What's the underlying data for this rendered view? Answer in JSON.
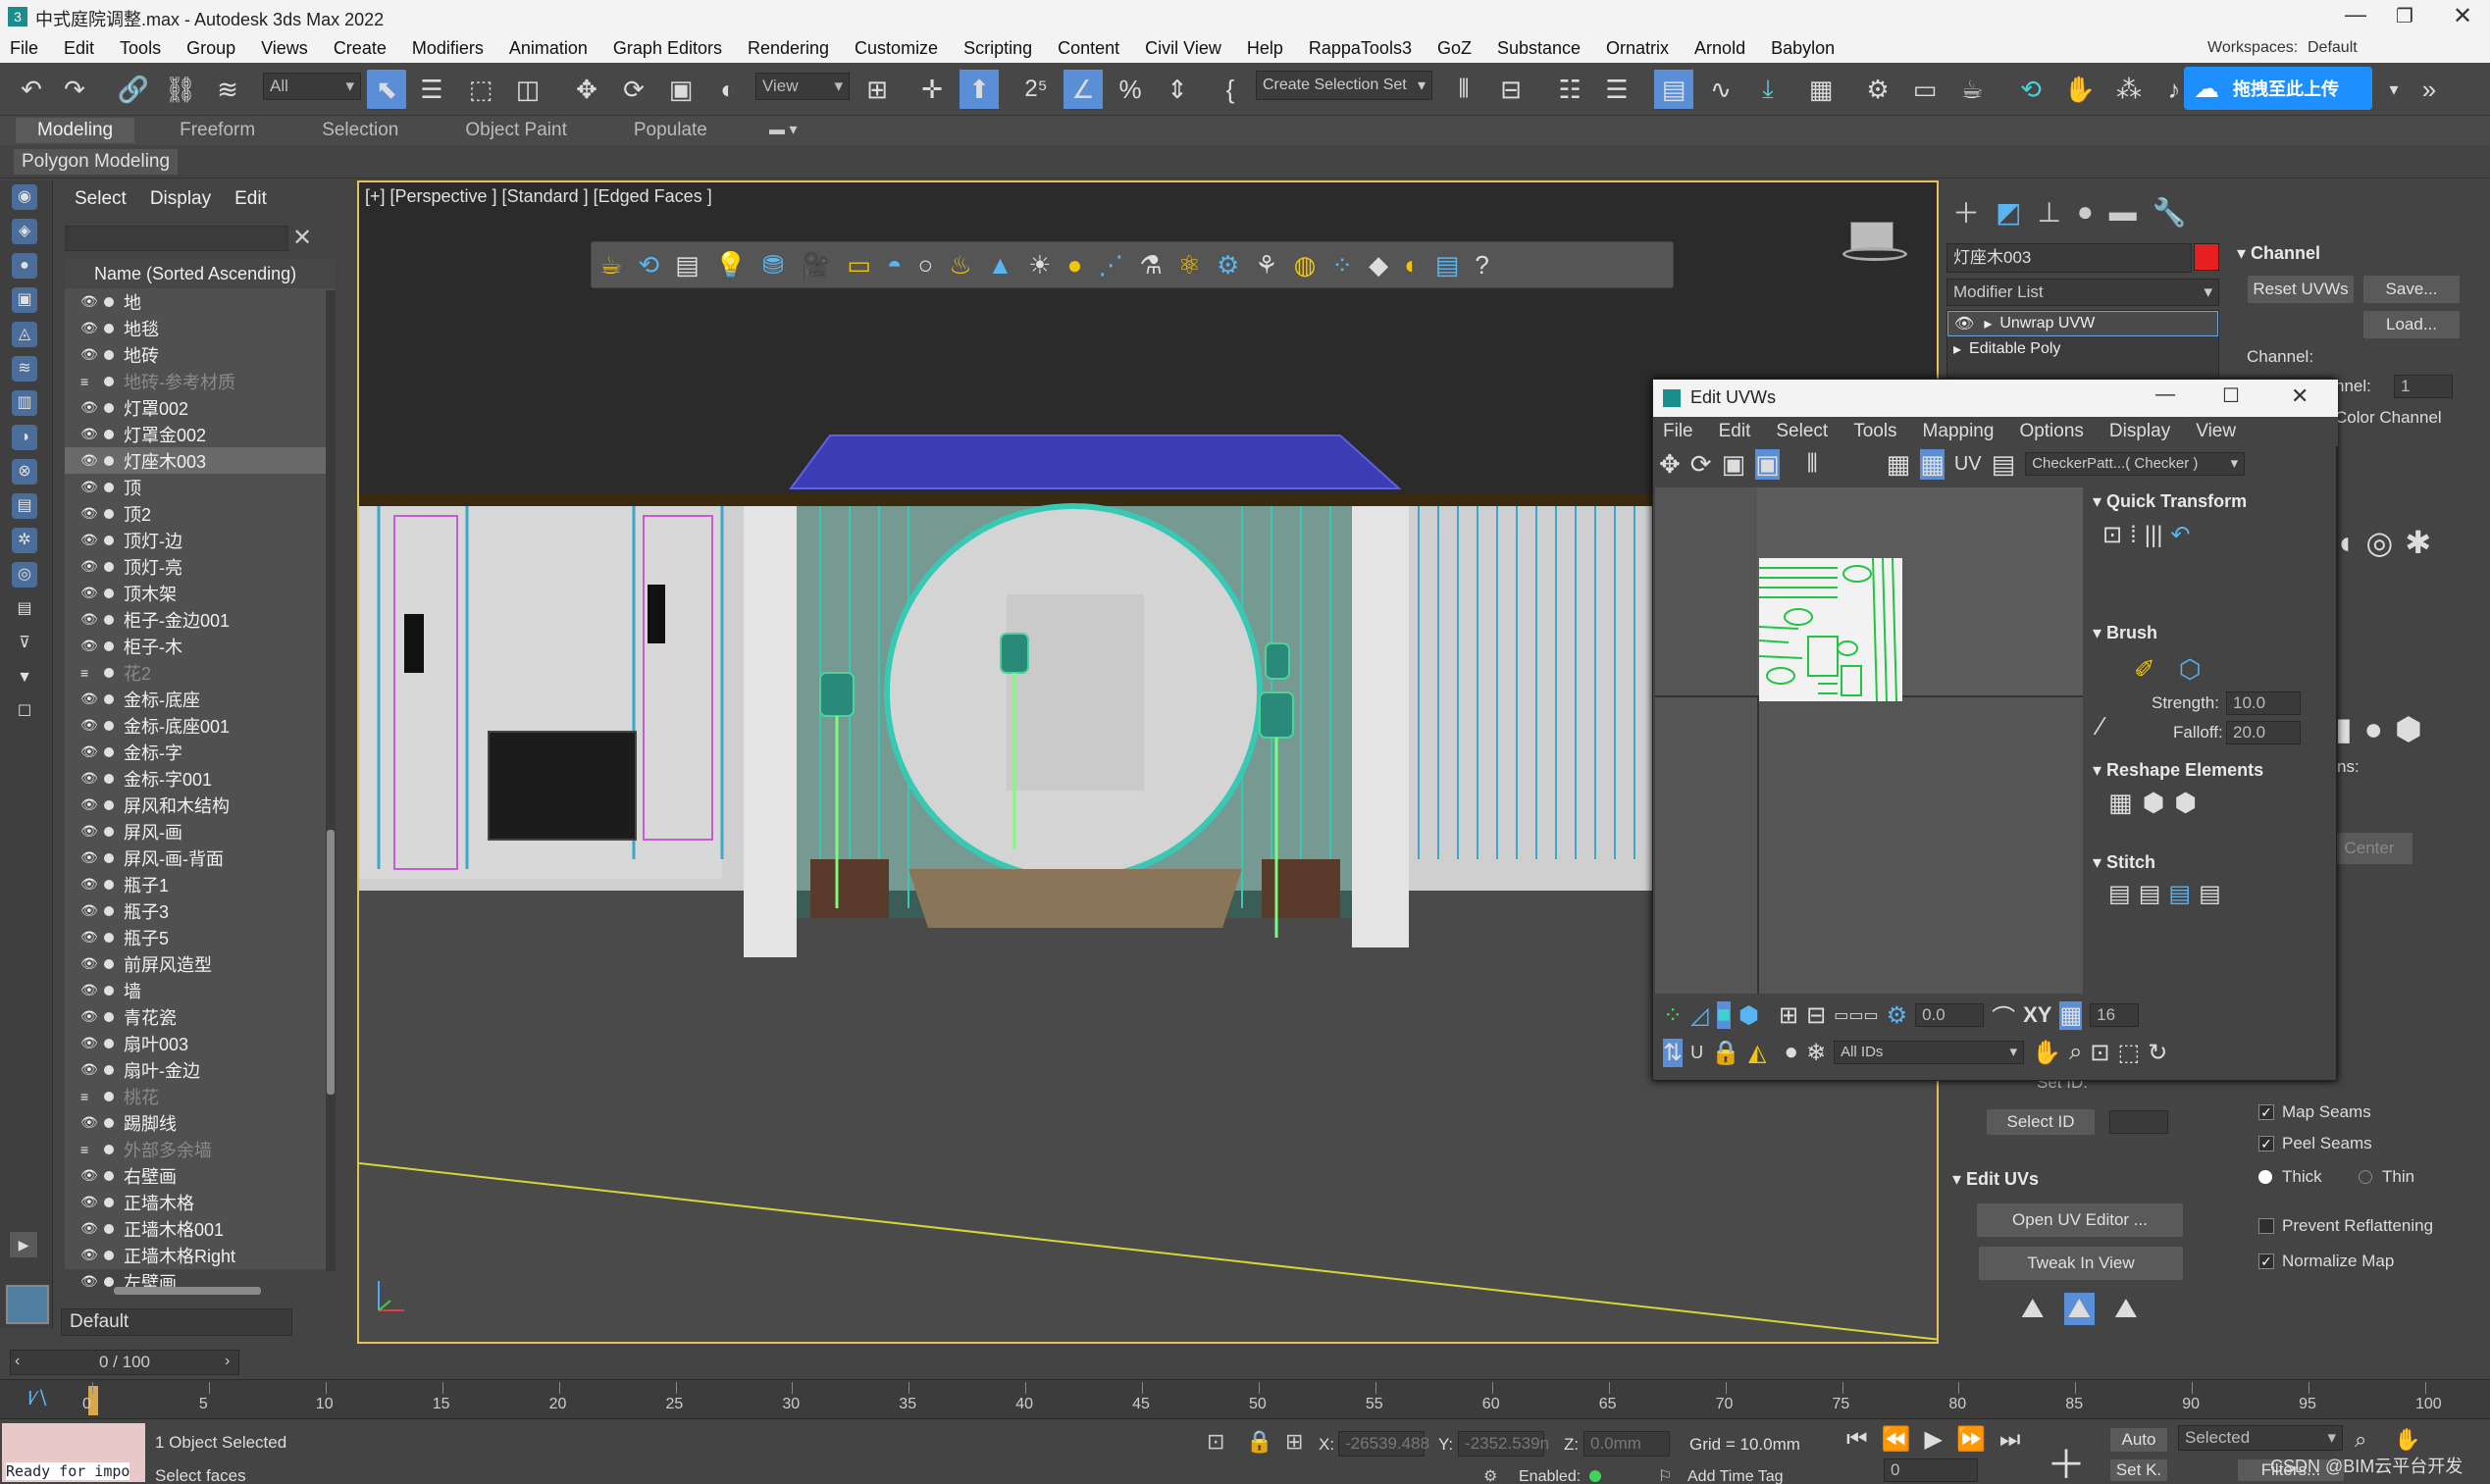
{
  "window": {
    "title": "中式庭院调整.max - Autodesk 3ds Max 2022",
    "workspaces_label": "Workspaces:",
    "workspace_value": "Default"
  },
  "menu": [
    "File",
    "Edit",
    "Tools",
    "Group",
    "Views",
    "Create",
    "Modifiers",
    "Animation",
    "Graph Editors",
    "Rendering",
    "Customize",
    "Scripting",
    "Content",
    "Civil View",
    "Help",
    "RappaTools3",
    "GoZ",
    "Substance",
    "Ornatrix",
    "Arnold",
    "Babylon"
  ],
  "toolbar": {
    "filter_value": "All",
    "refcoord_value": "View",
    "selection_set": "Create Selection Set",
    "upload_label": "拖拽至此上传"
  },
  "ribbon": {
    "tabs": [
      "Modeling",
      "Freeform",
      "Selection",
      "Object Paint",
      "Populate"
    ],
    "subtitle": "Polygon Modeling"
  },
  "scene_explorer": {
    "menu": [
      "Select",
      "Display",
      "Edit"
    ],
    "header": "Name (Sorted Ascending)",
    "items": [
      {
        "name": "地",
        "dim": false,
        "sel": false
      },
      {
        "name": "地毯",
        "dim": false,
        "sel": false
      },
      {
        "name": "地砖",
        "dim": false,
        "sel": false
      },
      {
        "name": "地砖-参考材质",
        "dim": true,
        "sel": false
      },
      {
        "name": "灯罩002",
        "dim": false,
        "sel": false
      },
      {
        "name": "灯罩金002",
        "dim": false,
        "sel": false
      },
      {
        "name": "灯座木003",
        "dim": false,
        "sel": true
      },
      {
        "name": "顶",
        "dim": false,
        "sel": false
      },
      {
        "name": "顶2",
        "dim": false,
        "sel": false
      },
      {
        "name": "顶灯-边",
        "dim": false,
        "sel": false
      },
      {
        "name": "顶灯-亮",
        "dim": false,
        "sel": false
      },
      {
        "name": "顶木架",
        "dim": false,
        "sel": false
      },
      {
        "name": "柜子-金边001",
        "dim": false,
        "sel": false
      },
      {
        "name": "柜子-木",
        "dim": false,
        "sel": false
      },
      {
        "name": "花2",
        "dim": true,
        "sel": false
      },
      {
        "name": "金标-底座",
        "dim": false,
        "sel": false
      },
      {
        "name": "金标-底座001",
        "dim": false,
        "sel": false
      },
      {
        "name": "金标-字",
        "dim": false,
        "sel": false
      },
      {
        "name": "金标-字001",
        "dim": false,
        "sel": false
      },
      {
        "name": "屏风和木结构",
        "dim": false,
        "sel": false
      },
      {
        "name": "屏风-画",
        "dim": false,
        "sel": false
      },
      {
        "name": "屏风-画-背面",
        "dim": false,
        "sel": false
      },
      {
        "name": "瓶子1",
        "dim": false,
        "sel": false
      },
      {
        "name": "瓶子3",
        "dim": false,
        "sel": false
      },
      {
        "name": "瓶子5",
        "dim": false,
        "sel": false
      },
      {
        "name": "前屏风造型",
        "dim": false,
        "sel": false
      },
      {
        "name": "墙",
        "dim": false,
        "sel": false
      },
      {
        "name": "青花瓷",
        "dim": false,
        "sel": false
      },
      {
        "name": "扇叶003",
        "dim": false,
        "sel": false
      },
      {
        "name": "扇叶-金边",
        "dim": false,
        "sel": false
      },
      {
        "name": "桃花",
        "dim": true,
        "sel": false
      },
      {
        "name": "踢脚线",
        "dim": false,
        "sel": false
      },
      {
        "name": "外部多余墙",
        "dim": true,
        "sel": false
      },
      {
        "name": "右壁画",
        "dim": false,
        "sel": false
      },
      {
        "name": "正墙木格",
        "dim": false,
        "sel": false
      },
      {
        "name": "正墙木格001",
        "dim": false,
        "sel": false
      },
      {
        "name": "正墙木格Right",
        "dim": false,
        "sel": false
      },
      {
        "name": "左壁画",
        "dim": false,
        "sel": false
      }
    ],
    "layer_value": "Default"
  },
  "viewport": {
    "label": "[+] [Perspective ] [Standard ] [Edged Faces ]"
  },
  "command_panel": {
    "object_name": "灯座木003",
    "modifier_list": "Modifier List",
    "stack": [
      "Unwrap UVW",
      "Editable Poly"
    ],
    "channel_title": "Channel",
    "reset_uvws": "Reset UVWs",
    "save": "Save...",
    "load": "Load...",
    "channel_label": "Channel:",
    "map_channel_label": "nnel:",
    "map_channel_value": "1",
    "color_channel": "Color Channel",
    "set_id_label": "Set ID:",
    "select_id": "Select ID",
    "edit_uvs_title": "Edit UVs",
    "open_uv_editor": "Open UV Editor ...",
    "tweak_in_view": "Tweak In View",
    "center": "Center",
    "ns_label": "ns:",
    "map_seams": "Map Seams",
    "peel_seams": "Peel Seams",
    "thick": "Thick",
    "thin": "Thin",
    "prevent_reflattening": "Prevent Reflattening",
    "normalize_map": "Normalize Map"
  },
  "uv_editor": {
    "title": "Edit UVWs",
    "menu": [
      "File",
      "Edit",
      "Select",
      "Tools",
      "Mapping",
      "Options",
      "Display",
      "View"
    ],
    "uv_label": "UV",
    "checker_value": "CheckerPatt...( Checker )",
    "quick_transform": "Quick Transform",
    "brush": "Brush",
    "strength_label": "Strength:",
    "strength_value": "10.0",
    "falloff_label": "Falloff:",
    "falloff_value": "20.0",
    "reshape_elements": "Reshape Elements",
    "stitch": "Stitch",
    "spinner_value": "0.0",
    "xy_label": "XY",
    "grid_value": "16",
    "u_label": "U",
    "ids_value": "All IDs"
  },
  "timeline": {
    "frame_label": "0 / 100",
    "ticks": [
      "0",
      "5",
      "10",
      "15",
      "20",
      "25",
      "30",
      "35",
      "40",
      "45",
      "50",
      "55",
      "60",
      "65",
      "70",
      "75",
      "80",
      "85",
      "90",
      "95",
      "100"
    ]
  },
  "status": {
    "maxscript": "Ready for impo",
    "objects_selected": "1 Object Selected",
    "prompt": "Select faces",
    "x_label": "X:",
    "x_value": "-26539.488",
    "y_label": "Y:",
    "y_value": "-2352.539n",
    "z_label": "Z:",
    "z_value": "0.0mm",
    "grid": "Grid = 10.0mm",
    "enabled": "Enabled:",
    "add_time_tag": "Add Time Tag",
    "auto": "Auto",
    "set_k": "Set K.",
    "selected_value": "Selected",
    "filters": "Filters...",
    "frame_value": "0",
    "watermark": "CSDN @BIM云平台开发"
  }
}
